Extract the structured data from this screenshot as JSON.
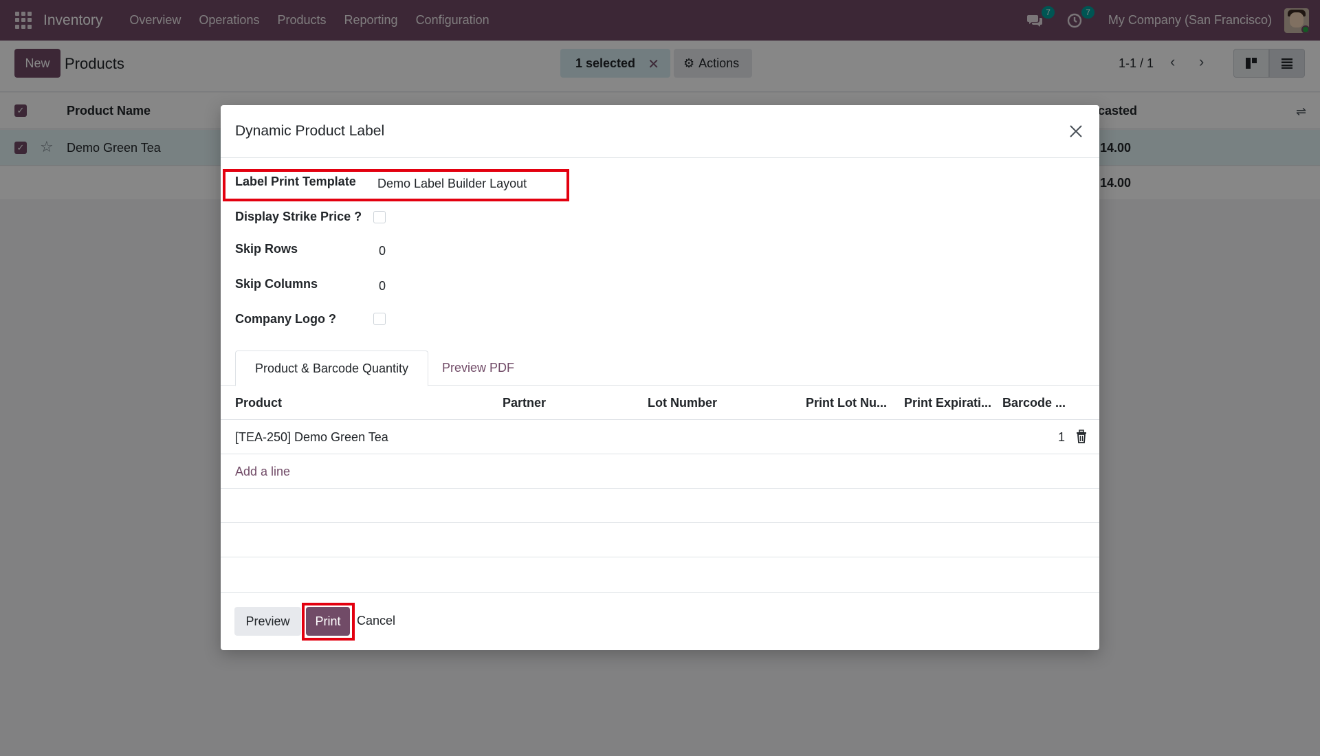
{
  "navbar": {
    "app_name": "Inventory",
    "menu": [
      "Overview",
      "Operations",
      "Products",
      "Reporting",
      "Configuration"
    ],
    "messages_count": "7",
    "activities_count": "7",
    "company": "My Company (San Francisco)"
  },
  "control_panel": {
    "new_label": "New",
    "title": "Products",
    "selected_label": "1 selected",
    "actions_label": "Actions",
    "pager": "1-1 / 1"
  },
  "list": {
    "col_product_name": "Product Name",
    "col_forecasted_partial": "casted",
    "row_name": "Demo Green Tea",
    "row_value": "14.00",
    "footer_value": "14.00"
  },
  "dialog": {
    "title": "Dynamic Product Label",
    "fields": {
      "template_label": "Label Print Template",
      "template_value": "Demo Label Builder Layout",
      "strike_label": "Display Strike Price ?",
      "skip_rows_label": "Skip Rows",
      "skip_rows_value": "0",
      "skip_cols_label": "Skip Columns",
      "skip_cols_value": "0",
      "logo_label": "Company Logo ?"
    },
    "tabs": [
      "Product & Barcode Quantity",
      "Preview PDF"
    ],
    "columns": [
      "Product",
      "Partner",
      "Lot Number",
      "Print Lot Nu...",
      "Print Expirati...",
      "Barcode ..."
    ],
    "lines": [
      {
        "product": "[TEA-250] Demo Green Tea",
        "quantity": "1"
      }
    ],
    "add_line": "Add a line",
    "buttons": {
      "preview": "Preview",
      "print": "Print",
      "cancel": "Cancel"
    }
  },
  "colors": {
    "brand": "#714b67",
    "highlight": "#e3000f",
    "badge": "#00a09d"
  }
}
